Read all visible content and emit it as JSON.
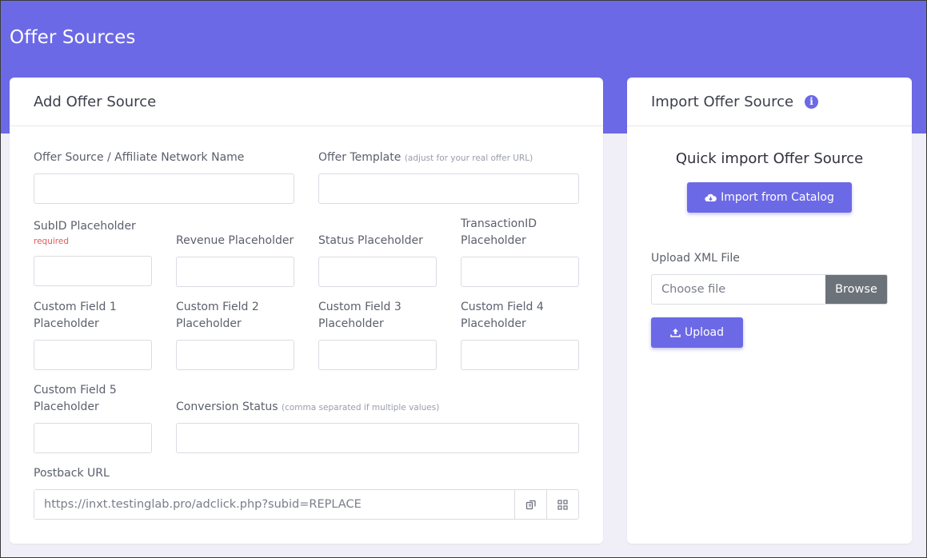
{
  "page": {
    "title": "Offer Sources"
  },
  "add_card": {
    "title": "Add Offer Source",
    "fields": {
      "network_name": {
        "label": "Offer Source / Affiliate Network Name",
        "value": ""
      },
      "offer_template": {
        "label": "Offer Template",
        "hint": "(adjust for your real offer URL)",
        "value": ""
      },
      "subid": {
        "label": "SubID Placeholder",
        "required": "required",
        "value": ""
      },
      "revenue": {
        "label": "Revenue Placeholder",
        "value": ""
      },
      "status": {
        "label": "Status Placeholder",
        "value": ""
      },
      "transaction_line1": "TransactionID",
      "transaction_line2": "Placeholder",
      "custom1_line1": "Custom Field 1",
      "custom2_line1": "Custom Field 2",
      "custom3_line1": "Custom Field 3",
      "custom4_line1": "Custom Field 4",
      "custom5_line1": "Custom Field 5",
      "placeholder_word": "Placeholder",
      "conversion_status": {
        "label": "Conversion Status",
        "hint": "(comma separated if multiple values)",
        "value": ""
      },
      "postback": {
        "label": "Postback URL",
        "value": "https://inxt.testinglab.pro/adclick.php?subid=REPLACE"
      }
    },
    "icons": {
      "copy": "copy-icon",
      "qr": "qr-code-icon"
    }
  },
  "import_card": {
    "title": "Import Offer Source",
    "info_icon": "info-icon",
    "quick_title": "Quick import Offer Source",
    "catalog_button": "Import from Catalog",
    "catalog_icon": "cloud-download-icon",
    "upload_label": "Upload XML File",
    "file_placeholder": "Choose file",
    "browse_label": "Browse",
    "upload_button": "Upload",
    "upload_icon": "upload-icon"
  },
  "colors": {
    "accent": "#6c69e6",
    "page_bg": "#f0eff7",
    "browse_bg": "#6c727a",
    "required": "#e05a5a"
  }
}
